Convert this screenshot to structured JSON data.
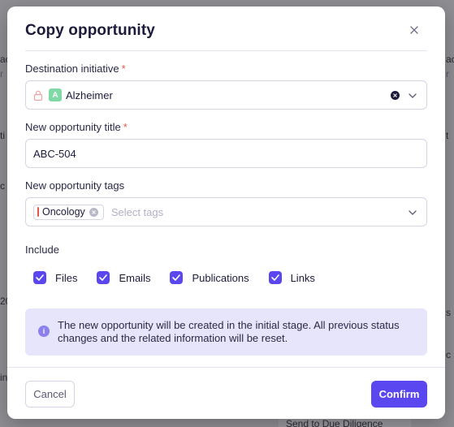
{
  "background": {
    "fragments_left": [
      "ac",
      "r",
      "ti",
      "c",
      "20",
      "in"
    ],
    "fragments_right": [
      "ac",
      "r",
      "t",
      "s",
      "c"
    ],
    "bottom_button": "Send to Due Diligence"
  },
  "modal": {
    "title": "Copy opportunity",
    "close_icon": "close-icon"
  },
  "destination": {
    "label": "Destination initiative",
    "required_mark": "*",
    "badge_letter": "A",
    "value": "Alzheimer"
  },
  "opportunity_title": {
    "label": "New opportunity title",
    "required_mark": "*",
    "value": "ABC-504"
  },
  "tags": {
    "label": "New opportunity tags",
    "chip": "Oncology",
    "placeholder": "Select tags"
  },
  "include": {
    "label": "Include",
    "options": [
      "Files",
      "Emails",
      "Publications",
      "Links"
    ]
  },
  "info": {
    "icon": "i",
    "text": "The new opportunity will be created in the initial stage. All previous status changes and the related information will be reset."
  },
  "footer": {
    "cancel": "Cancel",
    "confirm": "Confirm"
  },
  "colors": {
    "accent": "#5a47f0",
    "required": "#e4584a",
    "badge": "#7fd9a4",
    "info_bg": "#e7e5fb"
  }
}
